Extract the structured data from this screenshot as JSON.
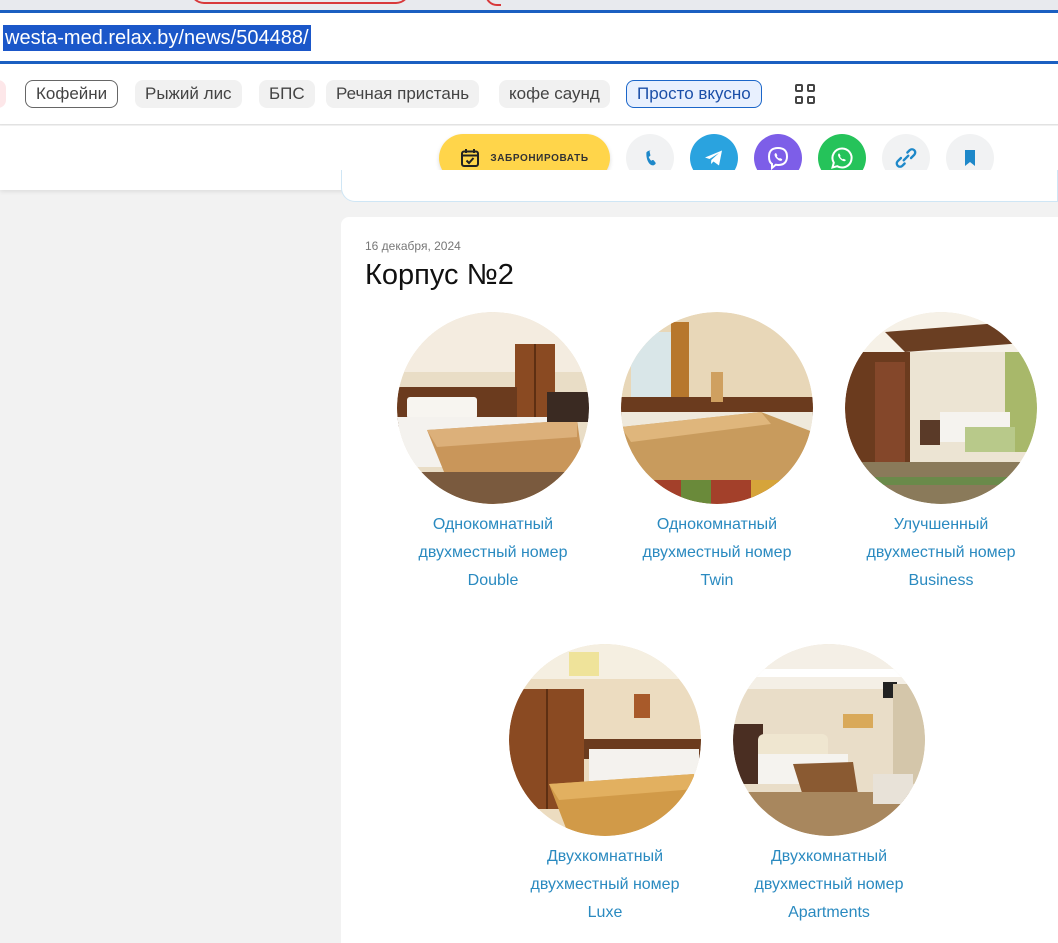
{
  "browser": {
    "url": "westa-med.relax.by/news/504488/"
  },
  "bookmarks": [
    {
      "label": "Кофейни",
      "style": "outline"
    },
    {
      "label": "Рыжий лис",
      "style": "plain"
    },
    {
      "label": "БПС",
      "style": "plain"
    },
    {
      "label": "Речная пристань",
      "style": "plain"
    },
    {
      "label": "кофе саунд",
      "style": "plain"
    },
    {
      "label": "Просто вкусно",
      "style": "outline-blue"
    }
  ],
  "action_bar": {
    "book_label": "ЗАБРОНИРОВАТЬ",
    "buttons": [
      {
        "name": "phone",
        "icon": "phone-icon",
        "bg": "#f1f2f3",
        "fg": "#1e88c9"
      },
      {
        "name": "telegram",
        "icon": "telegram-icon",
        "bg": "#2aa3df",
        "fg": "#ffffff"
      },
      {
        "name": "viber",
        "icon": "viber-icon",
        "bg": "#7d5ee8",
        "fg": "#ffffff"
      },
      {
        "name": "whatsapp",
        "icon": "whatsapp-icon",
        "bg": "#25c35a",
        "fg": "#ffffff"
      },
      {
        "name": "share-link",
        "icon": "link-icon",
        "bg": "#f1f2f3",
        "fg": "#1e88c9"
      },
      {
        "name": "bookmark",
        "icon": "bookmark-icon",
        "bg": "#f1f2f3",
        "fg": "#1e88c9"
      }
    ]
  },
  "article": {
    "date": "16 декабря, 2024",
    "title": "Корпус №2",
    "rooms": [
      {
        "line1": "Однокомнатный",
        "line2": "двухместный номер",
        "line3": "Double"
      },
      {
        "line1": "Однокомнатный",
        "line2": "двухместный номер",
        "line3": "Twin"
      },
      {
        "line1": "Улучшенный",
        "line2": "двухместный номер",
        "line3": "Business"
      },
      {
        "line1": "Двухкомнатный",
        "line2": "двухместный номер",
        "line3": "Luxe"
      },
      {
        "line1": "Двухкомнатный",
        "line2": "двухместный номер",
        "line3": "Apartments"
      }
    ]
  },
  "colors": {
    "accent_blue": "#1b57c9",
    "book_button": "#ffd54a",
    "room_link": "#2a8ac0"
  }
}
